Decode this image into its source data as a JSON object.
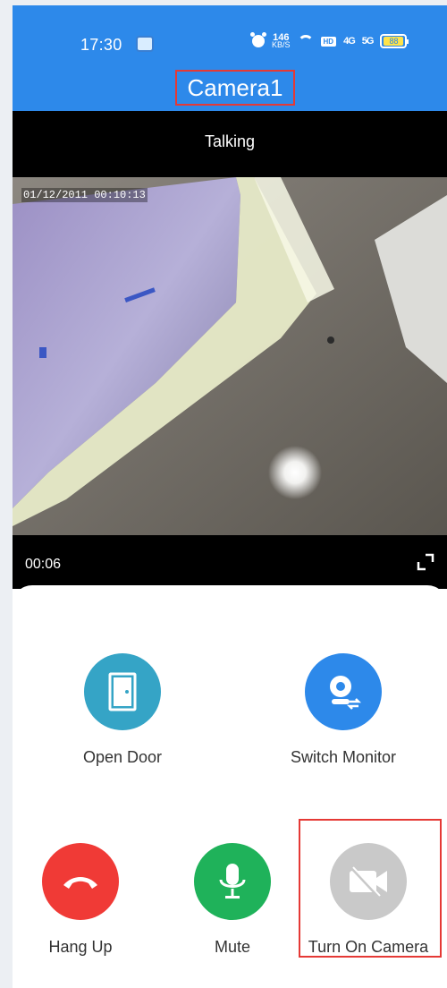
{
  "status_bar": {
    "time": "17:30",
    "net_speed_value": "146",
    "net_speed_unit": "KB/S",
    "hd_badge": "HD",
    "signal_1": "4G",
    "signal_2": "5G",
    "battery": "88"
  },
  "header": {
    "title": "Camera1"
  },
  "video": {
    "status": "Talking",
    "timestamp": "01/12/2011 00:10:13",
    "duration": "00:06"
  },
  "controls": {
    "open_door": "Open Door",
    "switch_monitor": "Switch Monitor",
    "hang_up": "Hang Up",
    "mute": "Mute",
    "turn_on_camera": "Turn On Camera"
  },
  "colors": {
    "header_bg": "#2d89ea",
    "open_door": "#35a4c6",
    "switch_monitor": "#2d89ea",
    "hang_up": "#f03a36",
    "mute": "#1fb25a",
    "camera_off": "#c9c9c9",
    "highlight": "#e53935"
  }
}
